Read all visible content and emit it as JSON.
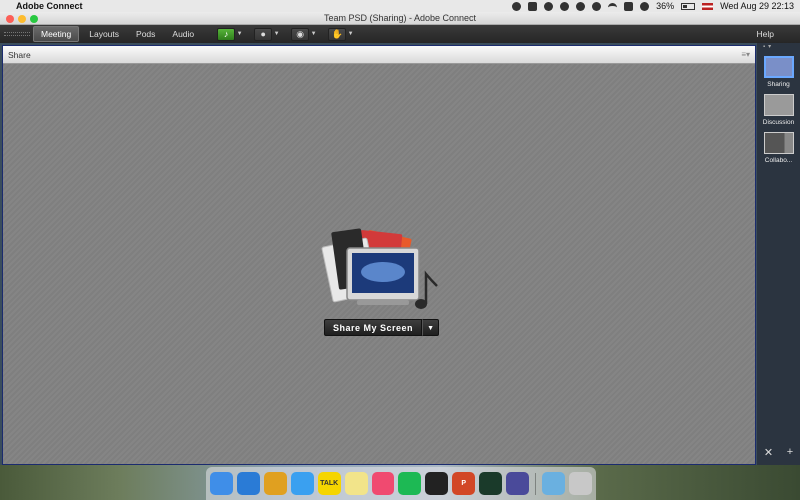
{
  "menubar": {
    "app_name": "Adobe Connect",
    "battery": "36%",
    "clock": "Wed Aug 29  22:13"
  },
  "window": {
    "title": "Team PSD (Sharing) - Adobe Connect"
  },
  "toolbar": {
    "menus": [
      "Meeting",
      "Layouts",
      "Pods",
      "Audio"
    ],
    "active_menu": "Meeting",
    "controls": [
      {
        "icon": "speaker-icon",
        "state": "on",
        "color": "#3a9b24"
      },
      {
        "icon": "microphone-icon"
      },
      {
        "icon": "webcam-icon"
      },
      {
        "icon": "raise-hand-icon"
      }
    ],
    "help_label": "Help"
  },
  "share_pod": {
    "title": "Share",
    "button_label": "Share My Screen"
  },
  "layouts": [
    {
      "label": "Sharing",
      "selected": true
    },
    {
      "label": "Discussion",
      "selected": false
    },
    {
      "label": "Collabo...",
      "selected": false
    }
  ],
  "dock": {
    "apps": [
      {
        "icon": "finder-icon",
        "color": "#3f8ee8",
        "text": ""
      },
      {
        "icon": "safari-icon",
        "color": "#2a7bd6",
        "text": ""
      },
      {
        "icon": "chrome-icon",
        "color": "#e0a020",
        "text": ""
      },
      {
        "icon": "messages-icon",
        "color": "#3aa0f0",
        "text": ""
      },
      {
        "icon": "kakaotalk-icon",
        "color": "#f5d500",
        "text": "TALK"
      },
      {
        "icon": "notes-icon",
        "color": "#f2e48a",
        "text": ""
      },
      {
        "icon": "itunes-icon",
        "color": "#f04a70",
        "text": ""
      },
      {
        "icon": "spotify-icon",
        "color": "#1db954",
        "text": ""
      },
      {
        "icon": "terminal-icon",
        "color": "#222222",
        "text": ""
      },
      {
        "icon": "powerpoint-icon",
        "color": "#d24726",
        "text": "P"
      },
      {
        "icon": "adobe-connect-icon",
        "color": "#1a3a2a",
        "text": ""
      },
      {
        "icon": "siri-icon",
        "color": "#4a4a9a",
        "text": ""
      },
      {
        "icon": "folder-icon",
        "color": "#6ab0e0",
        "text": ""
      },
      {
        "icon": "trash-icon",
        "color": "#c8c8c8",
        "text": ""
      }
    ]
  }
}
